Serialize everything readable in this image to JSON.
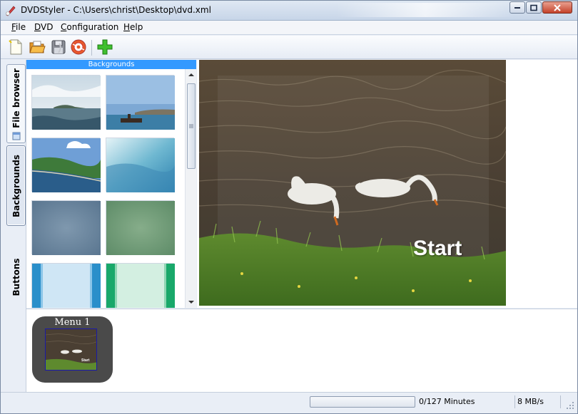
{
  "window": {
    "title": "DVDStyler - C:\\Users\\christ\\Desktop\\dvd.xml"
  },
  "menubar": {
    "items": [
      {
        "underline": "F",
        "rest": "ile"
      },
      {
        "underline": "D",
        "rest": "VD"
      },
      {
        "underline": "C",
        "rest": "onfiguration"
      },
      {
        "underline": "H",
        "rest": "elp"
      }
    ]
  },
  "toolbar": {
    "icons": [
      "new-icon",
      "open-icon",
      "save-icon",
      "burn-icon",
      "add-icon"
    ]
  },
  "sidetabs": {
    "items": [
      {
        "label": "File browser",
        "active": false
      },
      {
        "label": "Backgrounds",
        "active": true
      },
      {
        "label": "Buttons",
        "active": false
      }
    ]
  },
  "panel": {
    "header": "Backgrounds"
  },
  "preview": {
    "button_label": "Start"
  },
  "menus": {
    "items": [
      {
        "title": "Menu 1"
      }
    ]
  },
  "status": {
    "minutes": "0/127 Minutes",
    "rate": "8 MB/s"
  },
  "colors": {
    "panel_header": "#3399ff",
    "accent": "#3399ff"
  }
}
